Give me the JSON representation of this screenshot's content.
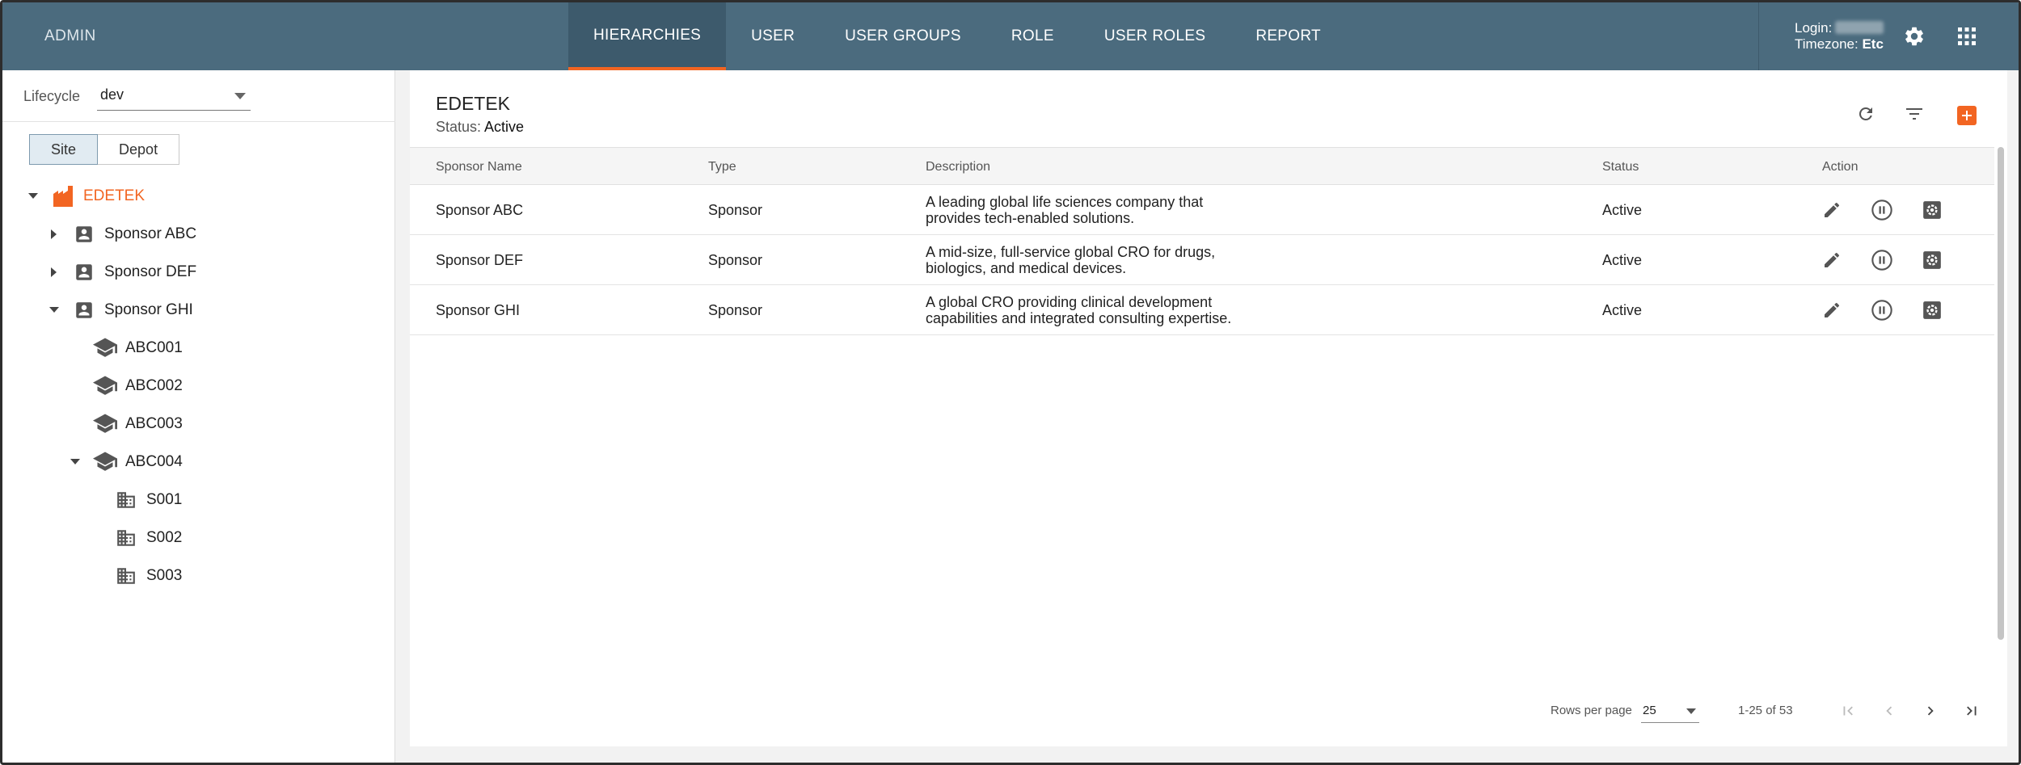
{
  "header": {
    "brand": "ADMIN",
    "tabs": [
      {
        "label": "HIERARCHIES",
        "active": true
      },
      {
        "label": "USER",
        "active": false
      },
      {
        "label": "USER GROUPS",
        "active": false
      },
      {
        "label": "ROLE",
        "active": false
      },
      {
        "label": "USER ROLES",
        "active": false
      },
      {
        "label": "REPORT",
        "active": false
      }
    ],
    "login_label": "Login:",
    "timezone_label": "Timezone:",
    "timezone_value": "Etc"
  },
  "sidebar": {
    "lifecycle_label": "Lifecycle",
    "lifecycle_value": "dev",
    "toggle": [
      "Site",
      "Depot"
    ],
    "tree": [
      {
        "label": "EDETEK",
        "icon": "building-icon",
        "expanded": true
      },
      {
        "label": "Sponsor ABC",
        "icon": "account-box-icon",
        "expanded": false
      },
      {
        "label": "Sponsor DEF",
        "icon": "account-box-icon",
        "expanded": false
      },
      {
        "label": "Sponsor GHI",
        "icon": "account-box-icon",
        "expanded": true
      },
      {
        "label": "ABC001",
        "icon": "school-icon"
      },
      {
        "label": "ABC002",
        "icon": "school-icon"
      },
      {
        "label": "ABC003",
        "icon": "school-icon"
      },
      {
        "label": "ABC004",
        "icon": "school-icon",
        "expanded": true
      },
      {
        "label": "S001",
        "icon": "office-icon"
      },
      {
        "label": "S002",
        "icon": "office-icon"
      },
      {
        "label": "S003",
        "icon": "office-icon"
      }
    ]
  },
  "main": {
    "title": "EDETEK",
    "status_label": "Status:",
    "status_value": "Active",
    "columns": [
      "Sponsor Name",
      "Type",
      "Description",
      "Status",
      "Action"
    ],
    "rows": [
      {
        "name": "Sponsor ABC",
        "type": "Sponsor",
        "desc1": "A leading global life sciences company that",
        "desc2": "provides tech-enabled solutions.",
        "status": "Active"
      },
      {
        "name": "Sponsor DEF",
        "type": "Sponsor",
        "desc1": "A mid-size, full-service global CRO for drugs,",
        "desc2": "biologics, and medical devices.",
        "status": "Active"
      },
      {
        "name": "Sponsor GHI",
        "type": "Sponsor",
        "desc1": "A global CRO providing clinical development",
        "desc2": "capabilities and integrated consulting expertise.",
        "status": "Active"
      }
    ],
    "pagination": {
      "rows_per_page_label": "Rows per page",
      "rows_per_page": "25",
      "range": "1-25 of 53"
    }
  },
  "colors": {
    "accent": "#f26522",
    "topbar": "#4b6b7e",
    "topbar_active": "#3d5a6c"
  }
}
